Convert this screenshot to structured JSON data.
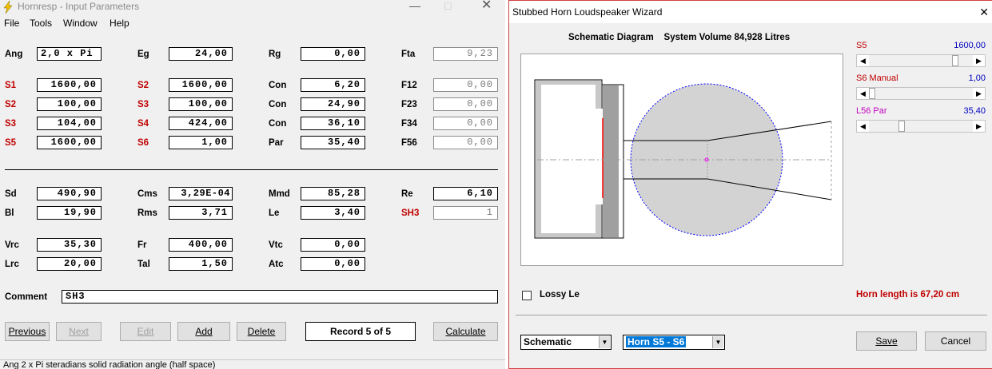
{
  "left_window": {
    "title": "Hornresp - Input Parameters",
    "menu": [
      "File",
      "Tools",
      "Window",
      "Help"
    ],
    "rows1": [
      {
        "l1": "Ang",
        "v1": "2,0 x Pi",
        "l2": "Eg",
        "v2": "24,00",
        "l3": "Rg",
        "v3": "0,00",
        "l4": "Fta",
        "v4": "9,23"
      },
      {
        "l1": "S1",
        "v1": "1600,00",
        "l2": "S2",
        "v2": "1600,00",
        "l3": "Con",
        "v3": "6,20",
        "l4": "F12",
        "v4": "0,00"
      },
      {
        "l1": "S2",
        "v1": "100,00",
        "l2": "S3",
        "v2": "100,00",
        "l3": "Con",
        "v3": "24,90",
        "l4": "F23",
        "v4": "0,00"
      },
      {
        "l1": "S3",
        "v1": "104,00",
        "l2": "S4",
        "v2": "424,00",
        "l3": "Con",
        "v3": "36,10",
        "l4": "F34",
        "v4": "0,00"
      },
      {
        "l1": "S5",
        "v1": "1600,00",
        "l2": "S6",
        "v2": "1,00",
        "l3": "Par",
        "v3": "35,40",
        "l4": "F56",
        "v4": "0,00"
      }
    ],
    "rows2": [
      {
        "l1": "Sd",
        "v1": "490,90",
        "l2": "Cms",
        "v2": "3,29E-04",
        "l3": "Mmd",
        "v3": "85,28",
        "l4": "Re",
        "v4": "6,10"
      },
      {
        "l1": "Bl",
        "v1": "19,90",
        "l2": "Rms",
        "v2": "3,71",
        "l3": "Le",
        "v3": "3,40",
        "l4": "SH3",
        "v4": "1"
      }
    ],
    "rows3": [
      {
        "l1": "Vrc",
        "v1": "35,30",
        "l2": "Fr",
        "v2": "400,00",
        "l3": "Vtc",
        "v3": "0,00"
      },
      {
        "l1": "Lrc",
        "v1": "20,00",
        "l2": "Tal",
        "v2": "1,50",
        "l3": "Atc",
        "v3": "0,00"
      }
    ],
    "comment_label": "Comment",
    "comment_value": "SH3",
    "buttons": {
      "previous": "Previous",
      "next": "Next",
      "edit": "Edit",
      "add": "Add",
      "delete": "Delete",
      "calculate": "Calculate"
    },
    "record": "Record 5 of 5",
    "status": "Ang   2 x Pi steradians solid radiation angle  (half space)"
  },
  "wizard": {
    "title": "Stubbed Horn Loudspeaker Wizard",
    "schematic_label": "Schematic Diagram",
    "system_volume": "System Volume 84,928 Litres",
    "sliders": [
      {
        "label": "S5",
        "value": "1600,00",
        "label_color": "#c00000",
        "value_color": "#0000c0",
        "position": 0.85
      },
      {
        "label": "S6  Manual",
        "value": "1,00",
        "label_color": "#c00000",
        "value_color": "#0000c0",
        "position": 0.0
      },
      {
        "label": "L56  Par",
        "value": "35,40",
        "label_color": "#c000c0",
        "value_color": "#0000c0",
        "position": 0.3
      }
    ],
    "lossy_le": "Lossy Le",
    "horn_length": "Horn length is 67,20 cm",
    "combo1": "Schematic",
    "combo2": "Horn S5 - S6",
    "save": "Save",
    "cancel": "Cancel"
  },
  "colors": {
    "label_red": "#c00000",
    "highlight": "#0078d7",
    "slider_value": "#0000c0",
    "magenta": "#c000c0"
  }
}
